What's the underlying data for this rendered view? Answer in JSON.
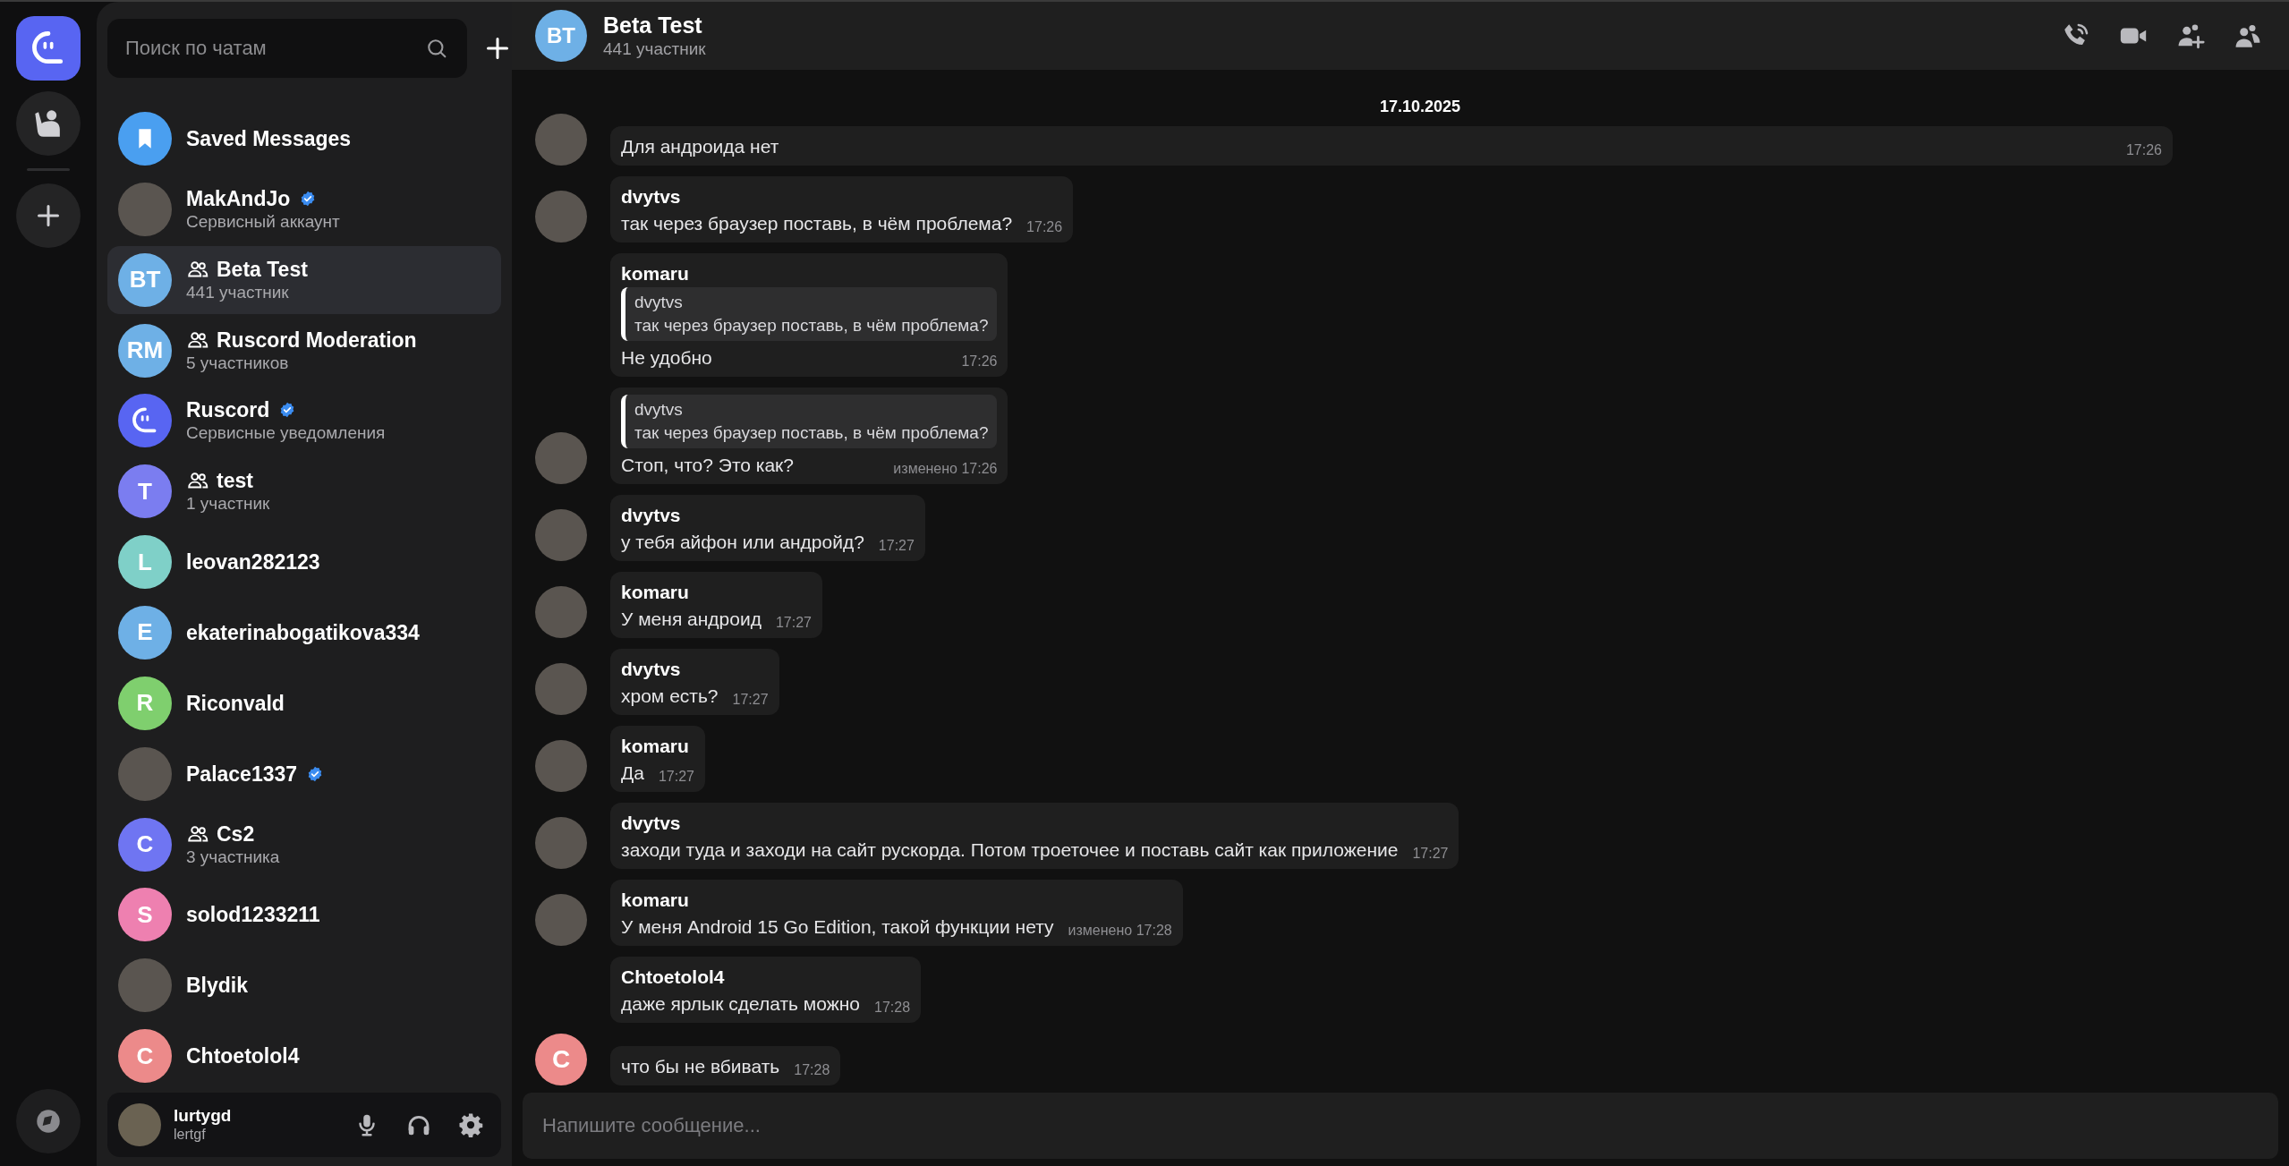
{
  "rail": {
    "items": [
      {
        "kind": "logo",
        "selected": true
      },
      {
        "kind": "profile",
        "selected": false
      },
      {
        "kind": "add",
        "selected": false
      }
    ],
    "bottom": {
      "kind": "explore"
    }
  },
  "sidebar": {
    "search": {
      "placeholder": "Поиск по чатам"
    },
    "chats": [
      {
        "name": "Saved Messages",
        "avatar": {
          "kind": "saved",
          "color": "#4a9ff0"
        },
        "group": false,
        "verified": false,
        "selected": false
      },
      {
        "name": "MakAndJo",
        "subtitle": "Сервисный аккаунт",
        "avatar": {
          "kind": "photo"
        },
        "group": false,
        "verified": true,
        "selected": false
      },
      {
        "name": "Beta Test",
        "subtitle": "441 участник",
        "avatar": {
          "kind": "letters",
          "text": "BT",
          "color": "#6eb0e6"
        },
        "group": true,
        "verified": false,
        "selected": true
      },
      {
        "name": "Ruscord Moderation",
        "subtitle": "5 участников",
        "avatar": {
          "kind": "letters",
          "text": "RM",
          "color": "#6eb0e6"
        },
        "group": true,
        "verified": false,
        "selected": false
      },
      {
        "name": "Ruscord",
        "subtitle": "Сервисные уведомления",
        "avatar": {
          "kind": "logo",
          "color": "#5865f2"
        },
        "group": false,
        "verified": true,
        "selected": false
      },
      {
        "name": "test",
        "subtitle": "1 участник",
        "avatar": {
          "kind": "letters",
          "text": "T",
          "color": "#7b7df0"
        },
        "group": true,
        "verified": false,
        "selected": false
      },
      {
        "name": "leovan282123",
        "avatar": {
          "kind": "letters",
          "text": "L",
          "color": "#7fd0c8"
        },
        "group": false,
        "verified": false,
        "selected": false
      },
      {
        "name": "ekaterinabogatikova334",
        "avatar": {
          "kind": "letters",
          "text": "E",
          "color": "#6eb0e6"
        },
        "group": false,
        "verified": false,
        "selected": false
      },
      {
        "name": "Riconvald",
        "avatar": {
          "kind": "letters",
          "text": "R",
          "color": "#7fcf6e"
        },
        "group": false,
        "verified": false,
        "selected": false
      },
      {
        "name": "Palace1337",
        "avatar": {
          "kind": "photo"
        },
        "group": false,
        "verified": true,
        "selected": false
      },
      {
        "name": "Cs2",
        "subtitle": "3 участника",
        "avatar": {
          "kind": "letters",
          "text": "C",
          "color": "#6f75f2"
        },
        "group": true,
        "verified": false,
        "selected": false
      },
      {
        "name": "solod1233211",
        "avatar": {
          "kind": "letters",
          "text": "S",
          "color": "#ee80b0"
        },
        "group": false,
        "verified": false,
        "selected": false
      },
      {
        "name": "Blydik",
        "avatar": {
          "kind": "photo"
        },
        "group": false,
        "verified": false,
        "selected": false
      },
      {
        "name": "Chtoetolol4",
        "avatar": {
          "kind": "letters",
          "text": "C",
          "color": "#ec8a8a"
        },
        "group": false,
        "verified": false,
        "selected": false
      }
    ],
    "user": {
      "name": "lurtygd",
      "handle": "lertgf"
    }
  },
  "header": {
    "avatar": {
      "text": "BT",
      "color": "#6eb0e6"
    },
    "title": "Beta Test",
    "subtitle": "441 участник",
    "actions": [
      {
        "kind": "call"
      },
      {
        "kind": "video"
      },
      {
        "kind": "add-member"
      },
      {
        "kind": "members"
      }
    ]
  },
  "date": "17.10.2025",
  "messages": [
    {
      "avatar": {
        "kind": "photo"
      },
      "text": "Для андроида нет",
      "time": "17:26"
    },
    {
      "author": "dvytvs",
      "avatar": {
        "kind": "photo"
      },
      "text": "так через браузер поставь, в чём проблема?",
      "time": "17:26"
    },
    {
      "author": "komaru",
      "reply": {
        "author": "dvytvs",
        "text": "так через браузер поставь, в чём проблема?"
      },
      "text": "Не удобно",
      "time": "17:26"
    },
    {
      "avatar": {
        "kind": "photo"
      },
      "reply": {
        "author": "dvytvs",
        "text": "так через браузер поставь, в чём проблема?"
      },
      "text": "Стоп, что? Это как?",
      "edited": "изменено",
      "time": "17:26"
    },
    {
      "author": "dvytvs",
      "avatar": {
        "kind": "photo"
      },
      "text": "у тебя айфон или андройд?",
      "time": "17:27"
    },
    {
      "author": "komaru",
      "avatar": {
        "kind": "photo"
      },
      "text": "У меня андроид",
      "time": "17:27"
    },
    {
      "author": "dvytvs",
      "avatar": {
        "kind": "photo"
      },
      "text": "хром есть?",
      "time": "17:27"
    },
    {
      "author": "komaru",
      "avatar": {
        "kind": "photo"
      },
      "text": "Да",
      "time": "17:27"
    },
    {
      "author": "dvytvs",
      "avatar": {
        "kind": "photo"
      },
      "text": "заходи туда и заходи на сайт рускорда. Потом троеточее и поставь сайт как приложение",
      "time": "17:27"
    },
    {
      "author": "komaru",
      "avatar": {
        "kind": "photo"
      },
      "text": "У меня Android 15 Go Edition, такой функции нету",
      "edited": "изменено",
      "time": "17:28"
    },
    {
      "author": "Chtoetolol4",
      "text": "даже ярлык сделать можно",
      "time": "17:28"
    },
    {
      "avatar": {
        "kind": "letters",
        "text": "C",
        "color": "#ec8a8a"
      },
      "text": "что бы не вбивать",
      "time": "17:28"
    }
  ],
  "composer": {
    "placeholder": "Напишите сообщение..."
  }
}
